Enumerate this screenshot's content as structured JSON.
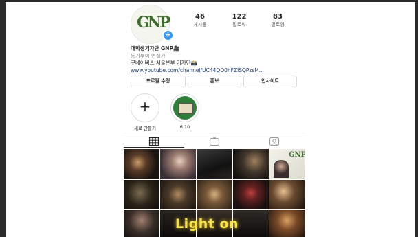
{
  "profile": {
    "avatar_logo": "GNP",
    "stats": [
      {
        "num": "46",
        "label": "게시물"
      },
      {
        "num": "122",
        "label": "팔로워"
      },
      {
        "num": "83",
        "label": "팔로잉"
      }
    ],
    "bio": {
      "name": "대학생기자단 GNP🎥",
      "category": "동기부여 연설가",
      "line": "굿네이버스 서울본부 기자단📸",
      "link": "www.youtube.com/channel/UC44QO0hFZlSQPzsM..."
    },
    "buttons": [
      "프로필 수정",
      "홍보",
      "인사이트"
    ],
    "highlights": [
      {
        "label": "새로 만들기"
      },
      {
        "label": "6.10"
      }
    ]
  },
  "tabs": [
    "grid-icon",
    "igtv-icon",
    "tagged-icon"
  ],
  "grid": {
    "overlay_text": "Light on"
  },
  "colors": {
    "accent": "#3897f0",
    "logo_green": "#3d6b2e",
    "overlay_yellow": "#f4e04a"
  }
}
